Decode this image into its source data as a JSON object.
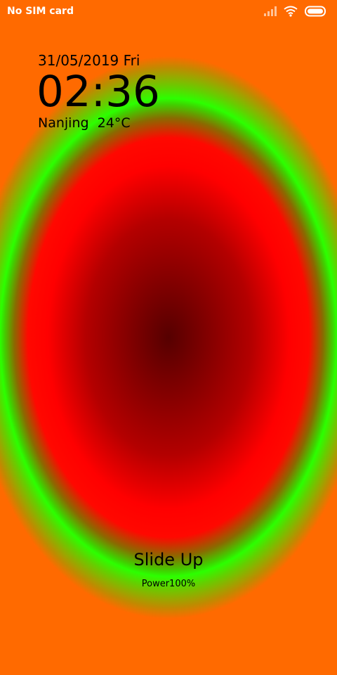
{
  "status_bar": {
    "carrier": "No SIM card",
    "icons": [
      "signal-icon",
      "wifi-icon",
      "battery-icon"
    ]
  },
  "lock_screen": {
    "date": "31/05/2019 Fri",
    "time": "02:36",
    "weather": "Nanjing  24°C",
    "slide_hint": "Slide Up",
    "power": "Power100%"
  },
  "colors": {
    "center": "#560000",
    "red_ring": "#ff0000",
    "green_ring": "#2cff00",
    "edge_orange": "#ff6a00",
    "text": "#000000",
    "status_text": "#ffffff"
  }
}
